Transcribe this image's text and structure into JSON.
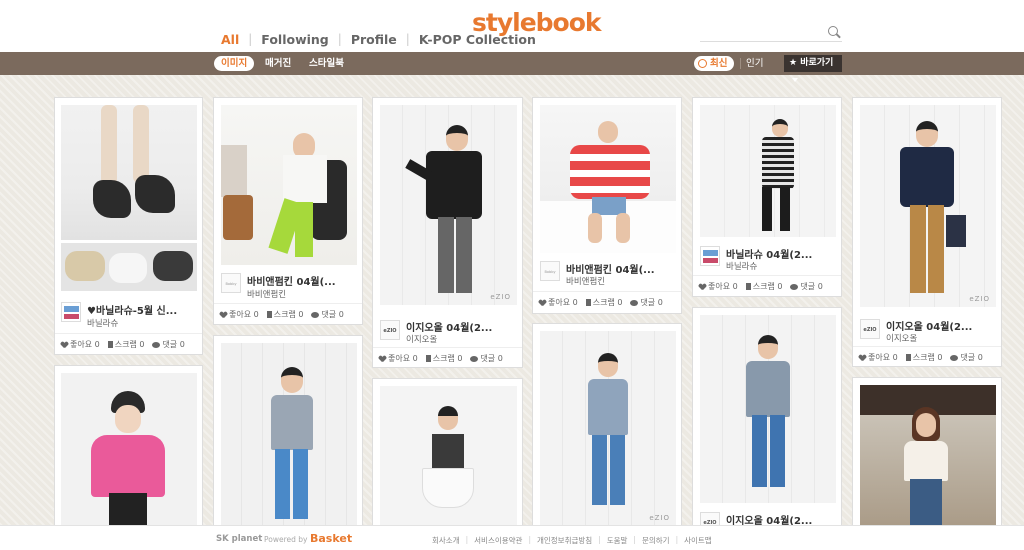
{
  "brand": {
    "logo": "stylebook",
    "accent": "#e8792f"
  },
  "topnav": {
    "tabs": [
      "All",
      "Following",
      "Profile",
      "K-POP Collection"
    ],
    "active": "All"
  },
  "search": {
    "placeholder": "",
    "icon": "search-icon"
  },
  "subnav": {
    "tabs": [
      "이미지",
      "매거진",
      "스타일북"
    ],
    "active": "이미지",
    "sort_recent": "최신",
    "sort_popular": "인기",
    "quick_menu": "★ 바로가기"
  },
  "cards": [
    {
      "title": "♥바닐라슈-5월 신...",
      "author": "바닐라슈",
      "likes": "좋아요 0",
      "scraps": "스크랩 0",
      "comments": "댓글 0",
      "avatar": "vanillashu-logo"
    },
    {
      "title": "바비앤펌킨 04월(...",
      "author": "바비앤펌킨",
      "likes": "좋아요 0",
      "scraps": "스크랩 0",
      "comments": "댓글 0",
      "avatar": "bobbypumpkin-logo"
    },
    {
      "title": "이지오올 04월(2...",
      "author": "이지오올",
      "likes": "좋아요 0",
      "scraps": "스크랩 0",
      "comments": "댓글 0",
      "avatar": "ezio-logo"
    },
    {
      "title": "바비앤펌킨 04월(...",
      "author": "바비앤펌킨",
      "likes": "좋아요 0",
      "scraps": "스크랩 0",
      "comments": "댓글 0",
      "avatar": "bobbypumpkin-logo"
    },
    {
      "title": "바닐라슈 04월(2...",
      "author": "바닐라슈",
      "likes": "좋아요 0",
      "scraps": "스크랩 0",
      "comments": "댓글 0",
      "avatar": "vanillashu-logo"
    },
    {
      "title": "이지오올 04월(2...",
      "author": "이지오올",
      "likes": "좋아요 0",
      "scraps": "스크랩 0",
      "comments": "댓글 0",
      "avatar": "ezio-logo"
    },
    {
      "title": "이지오올 04월(2...",
      "author": "",
      "likes": "",
      "scraps": "",
      "comments": "",
      "avatar": "ezio-logo"
    }
  ],
  "footer": {
    "sk": "SK planet",
    "powered": "Powered by",
    "basket": "Basket",
    "links": [
      "회사소개",
      "서비스이용약관",
      "개인정보취급방침",
      "도움말",
      "문의하기",
      "사이트맵"
    ]
  }
}
